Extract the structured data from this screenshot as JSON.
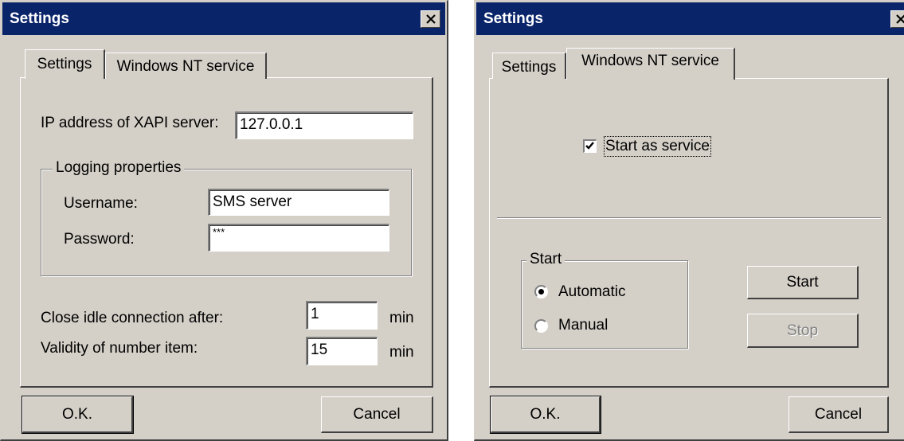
{
  "dialog1": {
    "title": "Settings",
    "tabs": [
      {
        "label": "Settings",
        "active": true
      },
      {
        "label": "Windows NT service",
        "active": false
      }
    ],
    "ip_label": "IP address of XAPI server:",
    "ip_value": "127.0.0.1",
    "logging_group": "Logging properties",
    "username_label": "Username:",
    "username_value": "SMS server",
    "password_label": "Password:",
    "password_value": "***",
    "idle_label": "Close idle connection after:",
    "idle_value": "1",
    "idle_unit": "min",
    "validity_label": "Validity of number item:",
    "validity_value": "15",
    "validity_unit": "min",
    "ok_label": "O.K.",
    "cancel_label": "Cancel"
  },
  "dialog2": {
    "title": "Settings",
    "tabs": [
      {
        "label": "Settings",
        "active": false
      },
      {
        "label": "Windows NT service",
        "active": true
      }
    ],
    "start_as_service_label": "Start as service",
    "start_as_service_checked": true,
    "start_group": "Start",
    "radio_automatic": "Automatic",
    "radio_manual": "Manual",
    "selected_mode": "Automatic",
    "start_button": "Start",
    "stop_button": "Stop",
    "stop_enabled": false,
    "ok_label": "O.K.",
    "cancel_label": "Cancel"
  },
  "colors": {
    "titlebar": "#0a246a",
    "dialog_face": "#d4d0c8",
    "disabled_text": "#808080"
  },
  "icons": [
    "close-icon",
    "checkmark-icon",
    "radio-dot-icon"
  ]
}
